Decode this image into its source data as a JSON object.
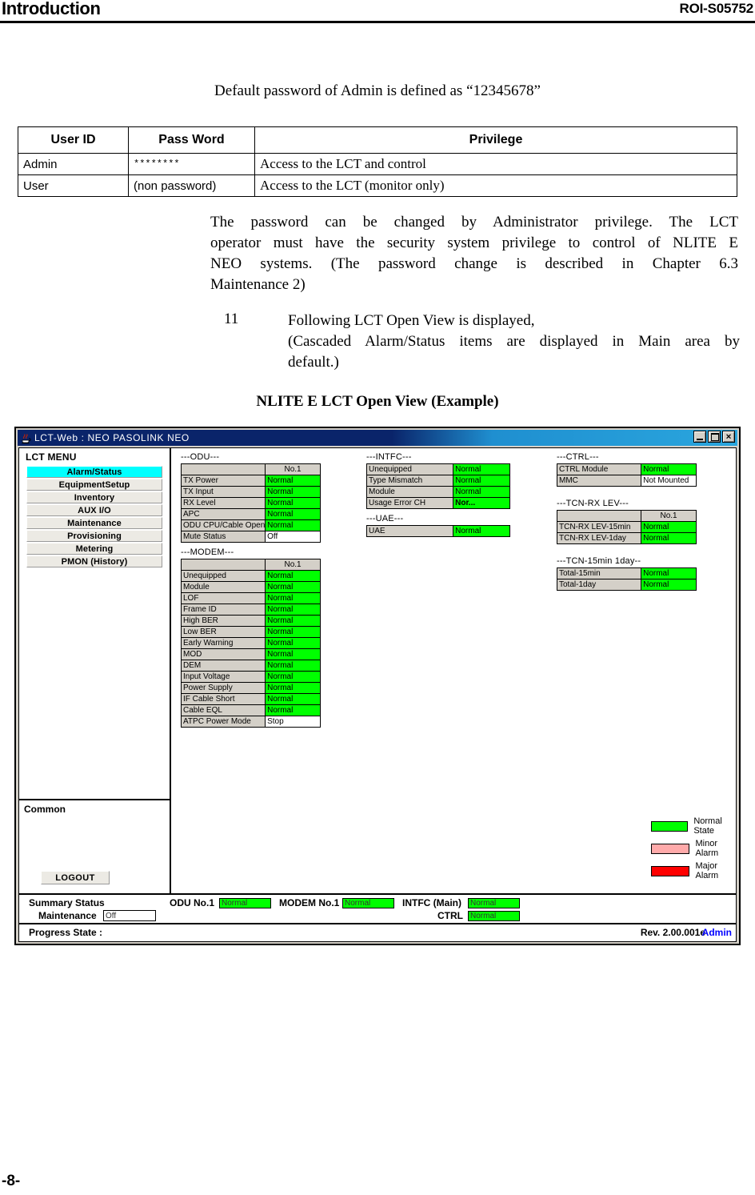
{
  "page": {
    "header_left": "Introduction",
    "header_right": "ROI-S05752",
    "page_number": "-8-"
  },
  "default_password_note": "Default password of Admin is defined as “12345678”",
  "privilege_table": {
    "headers": [
      "User ID",
      "Pass Word",
      "Privilege"
    ],
    "rows": [
      {
        "user_id": "Admin",
        "password": "********",
        "privilege": "Access to the LCT and control"
      },
      {
        "user_id": "User",
        "password": "(non password)",
        "privilege": "Access to the LCT (monitor only)"
      }
    ]
  },
  "paragraph": {
    "line1": "The  password  can  be  changed  by  Administrator  privilege.  The  LCT",
    "line2": "operator must have the security system privilege to control of NLITE E",
    "line3": "NEO  systems.  (The  password  change  is  described  in  Chapter  6.3",
    "line4": "Maintenance 2)"
  },
  "step": {
    "number": "11",
    "line1": "Following LCT Open View is displayed,",
    "line2": "(Cascaded  Alarm/Status  items  are  displayed  in  Main  area  by",
    "line3": "default.)"
  },
  "figure_title": "NLITE E LCT Open View (Example)",
  "lct": {
    "window_title": "LCT-Web : NEO PASOLINK NEO",
    "titlebar_buttons": {
      "minimize": "minimize-button",
      "maximize": "maximize-button",
      "close": "✕"
    },
    "menu": {
      "title": "LCT MENU",
      "items": [
        {
          "label": "Alarm/Status",
          "active": true
        },
        {
          "label": "EquipmentSetup",
          "active": false
        },
        {
          "label": "Inventory",
          "active": false
        },
        {
          "label": "AUX I/O",
          "active": false
        },
        {
          "label": "Maintenance",
          "active": false
        },
        {
          "label": "Provisioning",
          "active": false
        },
        {
          "label": "Metering",
          "active": false
        },
        {
          "label": "PMON (History)",
          "active": false
        }
      ]
    },
    "common": {
      "label": "Common",
      "logout_label": "LOGOUT"
    },
    "groups": {
      "odu": {
        "label": "---ODU---",
        "col_header": "No.1",
        "rows": [
          {
            "label": "TX Power",
            "value": "Normal",
            "state": "green"
          },
          {
            "label": "TX Input",
            "value": "Normal",
            "state": "green"
          },
          {
            "label": "RX Level",
            "value": "Normal",
            "state": "green"
          },
          {
            "label": "APC",
            "value": "Normal",
            "state": "green"
          },
          {
            "label": "ODU CPU/Cable Open",
            "value": "Normal",
            "state": "green"
          },
          {
            "label": "Mute Status",
            "value": "Off",
            "state": "white"
          }
        ]
      },
      "modem": {
        "label": "---MODEM---",
        "col_header": "No.1",
        "rows": [
          {
            "label": "Unequipped",
            "value": "Normal",
            "state": "green"
          },
          {
            "label": "Module",
            "value": "Normal",
            "state": "green"
          },
          {
            "label": "LOF",
            "value": "Normal",
            "state": "green"
          },
          {
            "label": "Frame ID",
            "value": "Normal",
            "state": "green"
          },
          {
            "label": "High BER",
            "value": "Normal",
            "state": "green"
          },
          {
            "label": "Low BER",
            "value": "Normal",
            "state": "green"
          },
          {
            "label": "Early Warning",
            "value": "Normal",
            "state": "green"
          },
          {
            "label": "MOD",
            "value": "Normal",
            "state": "green"
          },
          {
            "label": "DEM",
            "value": "Normal",
            "state": "green"
          },
          {
            "label": "Input Voltage",
            "value": "Normal",
            "state": "green"
          },
          {
            "label": "Power Supply",
            "value": "Normal",
            "state": "green"
          },
          {
            "label": "IF Cable Short",
            "value": "Normal",
            "state": "green"
          },
          {
            "label": "Cable EQL",
            "value": "Normal",
            "state": "green"
          },
          {
            "label": "ATPC Power Mode",
            "value": "Stop",
            "state": "white"
          }
        ]
      },
      "intfc": {
        "label": "---INTFC---",
        "rows": [
          {
            "label": "Unequipped",
            "value": "Normal",
            "state": "green"
          },
          {
            "label": "Type Mismatch",
            "value": "Normal",
            "state": "green"
          },
          {
            "label": "Module",
            "value": "Normal",
            "state": "green"
          },
          {
            "label": "Usage Error CH",
            "value": "Nor...",
            "state": "green-bold"
          }
        ]
      },
      "uae": {
        "label": "---UAE---",
        "rows": [
          {
            "label": "UAE",
            "value": "Normal",
            "state": "green"
          }
        ]
      },
      "ctrl": {
        "label": "---CTRL---",
        "rows": [
          {
            "label": "CTRL Module",
            "value": "Normal",
            "state": "green"
          },
          {
            "label": "MMC",
            "value": "Not Mounted",
            "state": "white"
          }
        ]
      },
      "tcn_rx_lev": {
        "label": "---TCN-RX LEV---",
        "col_header": "No.1",
        "rows": [
          {
            "label": "TCN-RX LEV-15min",
            "value": "Normal",
            "state": "green"
          },
          {
            "label": "TCN-RX LEV-1day",
            "value": "Normal",
            "state": "green"
          }
        ]
      },
      "tcn_15min_1day": {
        "label": "---TCN-15min 1day--",
        "rows": [
          {
            "label": "Total-15min",
            "value": "Normal",
            "state": "green"
          },
          {
            "label": "Total-1day",
            "value": "Normal",
            "state": "green"
          }
        ]
      }
    },
    "legend": [
      {
        "label": "Normal State",
        "color": "#00ff00"
      },
      {
        "label": "Minor Alarm",
        "color": "#ffaaaa"
      },
      {
        "label": "Major Alarm",
        "color": "#ff0000"
      }
    ],
    "summary": {
      "title": "Summary Status",
      "maintenance_label": "Maintenance",
      "maintenance_value": "Off",
      "items": [
        {
          "label": "ODU No.1",
          "value": "Normal"
        },
        {
          "label": "MODEM No.1",
          "value": "Normal"
        },
        {
          "label": "INTFC (Main)",
          "value": "Normal"
        },
        {
          "label": "CTRL",
          "value": "Normal"
        }
      ]
    },
    "progress": {
      "label": "Progress State :",
      "revision": "Rev. 2.00.001e",
      "user": "Admin"
    }
  }
}
